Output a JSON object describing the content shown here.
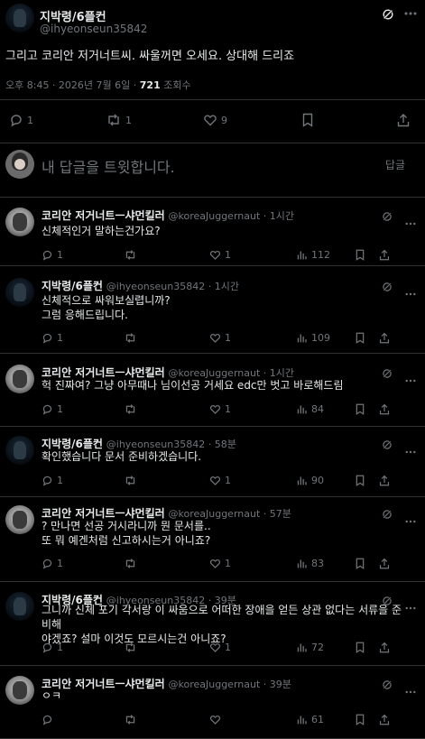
{
  "main_tweet": {
    "author_name": "지박령/6플컨",
    "author_handle": "@ihyeonseun35842",
    "text": "그리고 코리안 저거너트씨. 싸울꺼면 오세요. 상대해 드리죠",
    "timestamp": "오후 8:45 · 2026년 7월 6일 · ",
    "views_count": "721",
    "views_label": " 조회수",
    "reply_count": "1",
    "retweet_count": "1",
    "like_count": "9"
  },
  "reply_box": {
    "placeholder": "내 답글을 트윗합니다.",
    "button_label": "답글"
  },
  "replies": [
    {
      "name": "코리안 저거너트ㅡ샤먼킬러",
      "meta": "@koreaJuggernaut · 1시간",
      "lines": [
        "신체적인거 말하는건가요?"
      ],
      "replies": "1",
      "likes": "1",
      "views": "112"
    },
    {
      "name": "지박령/6플컨",
      "meta": "@ihyeonseun35842 · 1시간",
      "lines": [
        "신체적으로 싸워보실렵니까?",
        "그럼 응해드립니다."
      ],
      "replies": "1",
      "likes": "1",
      "views": "109"
    },
    {
      "name": "코리안 저거너트ㅡ샤먼킬러",
      "meta": "@koreaJuggernaut · 1시간",
      "lines": [
        "헉 진짜여? 그냥 아무때나 님이선공 거세요  edc만 벗고 바로해드림"
      ],
      "replies": "1",
      "likes": "1",
      "views": "84"
    },
    {
      "name": "지박령/6플컨",
      "meta": "@ihyeonseun35842 · 58분",
      "lines": [
        "확인했습니다 문서 준비하겠습니다."
      ],
      "replies": "1",
      "likes": "1",
      "views": "90"
    },
    {
      "name": "코리안 저거너트ㅡ샤먼킬러",
      "meta": "@koreaJuggernaut · 57분",
      "lines": [
        "? 만나면 선공 거시라니까 뭔 문서를..",
        "또 뭐 예겐처럼 신고하시는거 아니죠?"
      ],
      "replies": "1",
      "likes": "1",
      "views": "83"
    },
    {
      "name": "지박령/6플컨",
      "meta": "@ihyeonseun35842 · 39분",
      "lines": [
        "그니까 신체 포기 각서랑 이 싸움으로 어떠한 장애을 얻든 상관 없다는 서류을 준비해",
        "야겠죠? 설마 이것도 모르시는건 아니죠?"
      ],
      "replies": "1",
      "likes": "1",
      "views": "72"
    },
    {
      "name": "코리안 저거너트ㅡ샤먼킬러",
      "meta": "@koreaJuggernaut · 39분",
      "lines": [
        "ㅇㅋ"
      ],
      "replies": "",
      "likes": "",
      "views": "61"
    }
  ],
  "colors": {
    "text": "#e7e9ea",
    "muted": "#71767b",
    "divider": "#2f3336",
    "background": "#000000"
  }
}
